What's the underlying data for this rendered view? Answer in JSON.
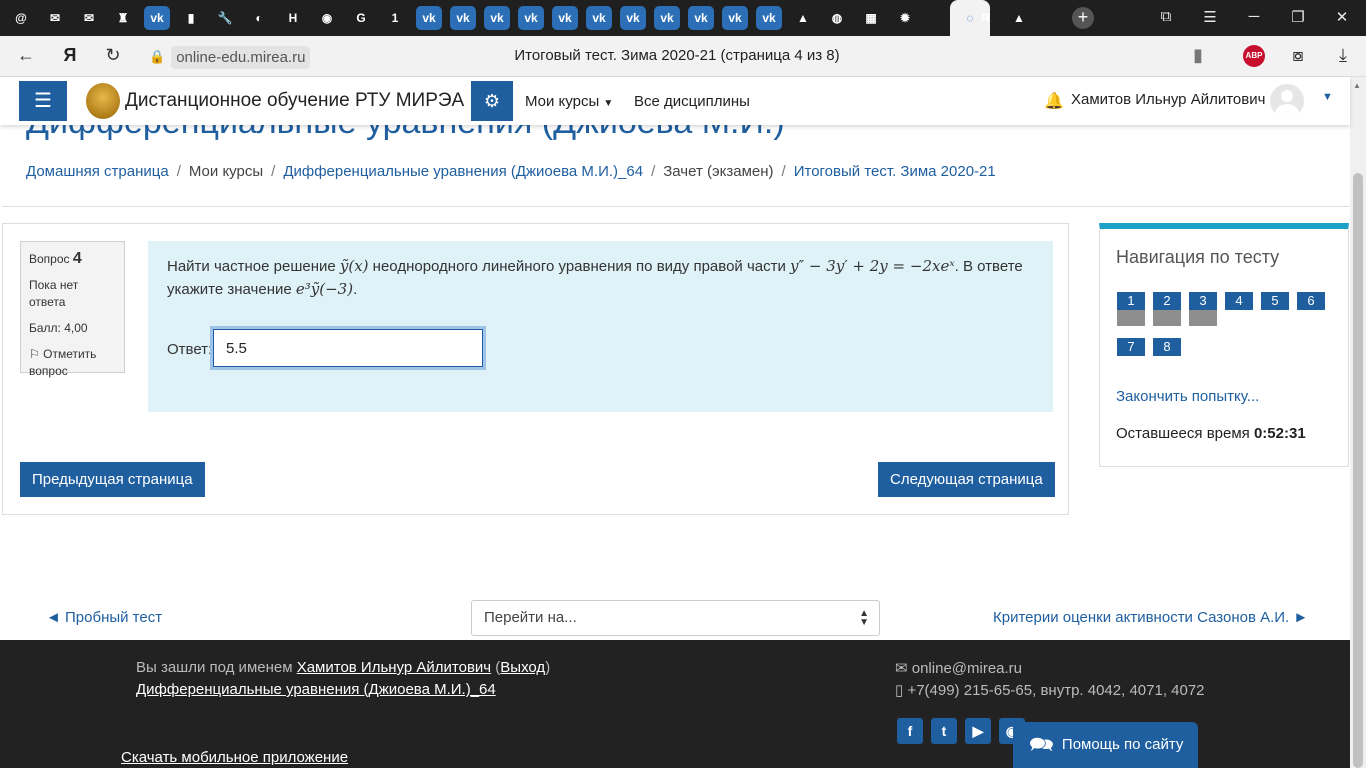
{
  "browser": {
    "tabs": [
      {
        "icon": "at-icon",
        "label": "@"
      },
      {
        "icon": "mail-icon",
        "label": "✉"
      },
      {
        "icon": "mail-icon",
        "label": "✉"
      },
      {
        "icon": "app-icon",
        "label": "♜"
      },
      {
        "icon": "vk-icon",
        "label": "vk"
      },
      {
        "icon": "app-icon",
        "label": "▮"
      },
      {
        "icon": "wrench-icon",
        "label": "🔧"
      },
      {
        "icon": "app-icon",
        "label": "◐"
      },
      {
        "icon": "app-icon",
        "label": "H"
      },
      {
        "icon": "app-icon",
        "label": "◉"
      },
      {
        "icon": "app-icon",
        "label": "G"
      },
      {
        "icon": "app-icon",
        "label": "1"
      },
      {
        "icon": "vk-icon",
        "label": "vk"
      },
      {
        "icon": "vk-icon",
        "label": "vk"
      },
      {
        "icon": "vk-icon",
        "label": "vk"
      },
      {
        "icon": "vk-icon",
        "label": "vk"
      },
      {
        "icon": "vk-icon",
        "label": "vk"
      },
      {
        "icon": "vk-icon",
        "label": "vk"
      },
      {
        "icon": "vk-icon",
        "label": "vk"
      },
      {
        "icon": "vk-icon",
        "label": "vk"
      },
      {
        "icon": "vk-icon",
        "label": "vk"
      },
      {
        "icon": "vk-icon",
        "label": "vk"
      },
      {
        "icon": "vk-icon",
        "label": "vk"
      },
      {
        "icon": "image-icon",
        "label": "▲"
      },
      {
        "icon": "app-icon",
        "label": "◍"
      },
      {
        "icon": "app-icon",
        "label": "▦"
      },
      {
        "icon": "gear-icon",
        "label": "✹"
      },
      {
        "icon": "chat-icon",
        "label": "◌"
      },
      {
        "icon": "yandex-icon",
        "label": "Я"
      },
      {
        "icon": "image-icon",
        "label": "▲"
      }
    ],
    "url": "online-edu.mirea.ru",
    "page_title": "Итоговый тест. Зима 2020-21 (страница 4 из 8)",
    "abp_label": "ABP"
  },
  "navbar": {
    "site_name": "Дистанционное обучение РТУ МИРЭА",
    "my_courses": "Мои курсы",
    "all_disciplines": "Все дисциплины",
    "user_name": "Хамитов Ильнур Айлитович"
  },
  "header": {
    "course_title": "Дифференциальные уравнения (Джиоева М.И.)",
    "breadcrumb": [
      "Домашняя страница",
      "Мои курсы",
      "Дифференциальные уравнения (Джиоева М.И.)_64",
      "Зачет (экзамен)",
      "Итоговый тест. Зима 2020-21"
    ]
  },
  "question": {
    "label": "Вопрос",
    "number": "4",
    "status": "Пока нет ответа",
    "score": "Балл: 4,00",
    "flag": "Отметить вопрос",
    "text_part1": "Найти частное решение ",
    "math1": "ỹ(x)",
    "text_part2": " неоднородного линейного уравнения по виду правой части ",
    "math2": "y″ − 3y′ + 2y = −2xeˣ",
    "text_part3": ". В ответе укажите значение ",
    "math3": "e³ỹ(−3)",
    "text_part4": ".",
    "answer_label": "Ответ:",
    "answer_value": "5.5"
  },
  "buttons": {
    "prev_page": "Предыдущая страница",
    "next_page": "Следующая страница"
  },
  "quiz_nav": {
    "title": "Навигация по тесту",
    "questions": [
      {
        "n": "1",
        "answered": true
      },
      {
        "n": "2",
        "answered": true
      },
      {
        "n": "3",
        "answered": true
      },
      {
        "n": "4",
        "answered": false
      },
      {
        "n": "5",
        "answered": false
      },
      {
        "n": "6",
        "answered": false
      },
      {
        "n": "7",
        "answered": false
      },
      {
        "n": "8",
        "answered": false
      }
    ],
    "finish": "Закончить попытку...",
    "time_label": "Оставшееся время",
    "time_value": "0:52:31"
  },
  "activity_nav": {
    "prev": "◄ Пробный тест",
    "jump": "Перейти на...",
    "next": "Критерии оценки активности Сазонов А.И. ►"
  },
  "footer": {
    "logged_prefix": "Вы зашли под именем ",
    "logged_user": "Хамитов Ильнур Айлитович",
    "logout": "Выход",
    "course": "Дифференциальные уравнения (Джиоева М.И.)_64",
    "mobile_app": "Скачать мобильное приложение",
    "email": "online@mirea.ru",
    "phone": "+7(499) 215-65-65, внутр. 4042, 4071, 4072",
    "help": "Помощь по сайту"
  },
  "colors": {
    "brand": "#1f5fa0",
    "question_bg": "#def2f8",
    "block_accent": "#1aa3c7",
    "footer_bg": "#222222"
  }
}
